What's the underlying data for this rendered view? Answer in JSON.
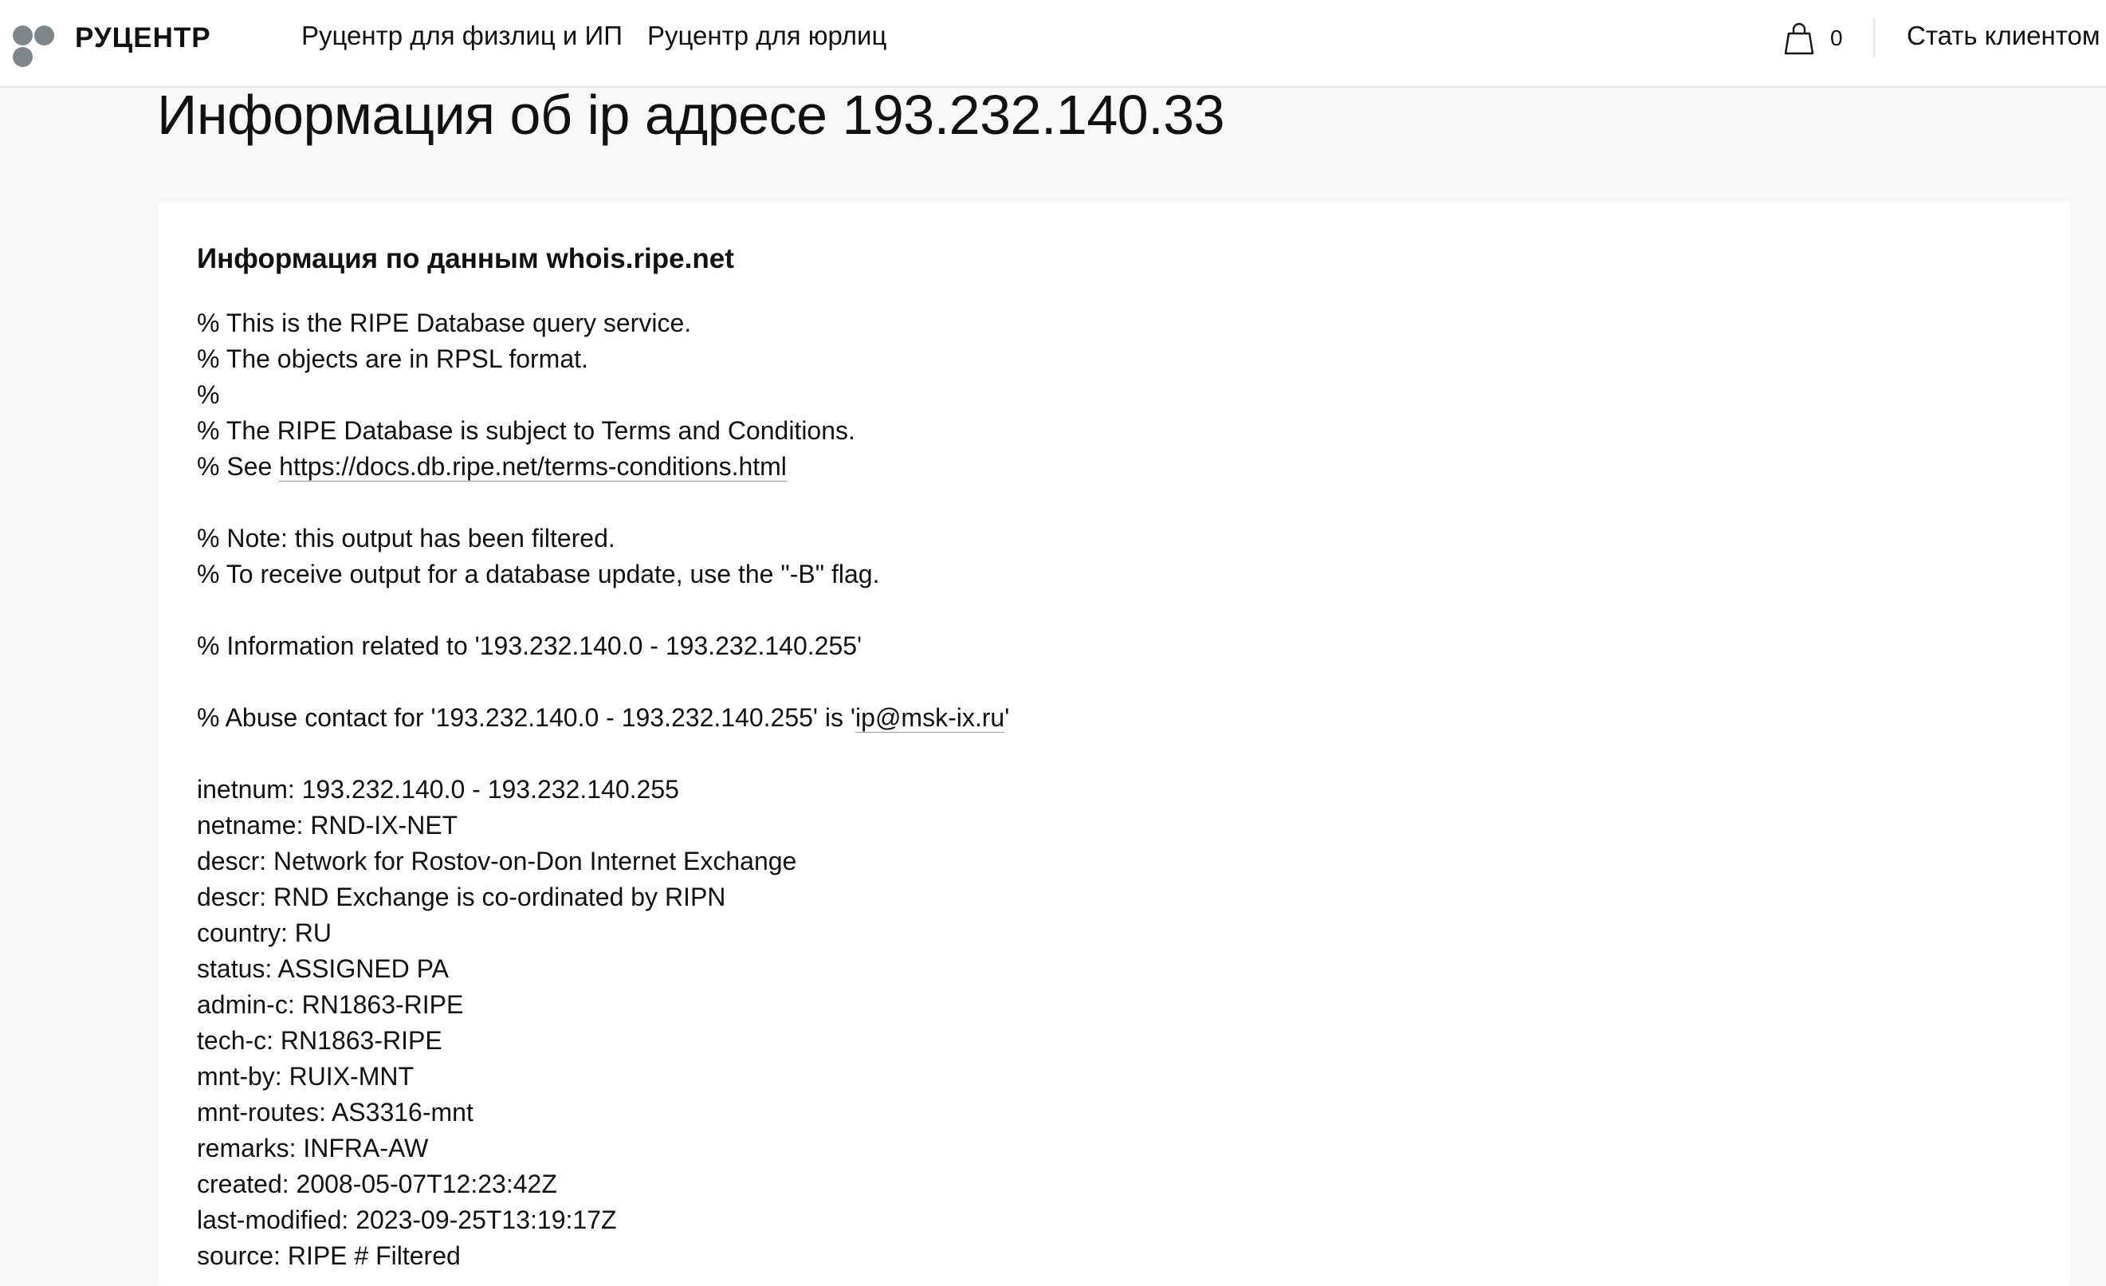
{
  "header": {
    "logo_text": "РУЦЕНТР",
    "nav": [
      "Руцентр для физлиц и ИП",
      "Руцентр для юрлиц"
    ],
    "cart_count": "0",
    "cta_label": "Стать клиентом",
    "icons": [
      "logo-dots-icon",
      "shopping-bag-icon"
    ]
  },
  "page": {
    "title": "Информация об ip адресе 193.232.140.33"
  },
  "whois": {
    "heading": "Информация по данным whois.ripe.net",
    "line_01": "% This is the RIPE Database query service.",
    "line_02": "% The objects are in RPSL format.",
    "line_03": "%",
    "line_04": "% The RIPE Database is subject to Terms and Conditions.",
    "line_05_prefix": "% See ",
    "line_05_link": "https://docs.db.ripe.net/terms-conditions.html",
    "line_07": "% Note: this output has been filtered.",
    "line_08": "% To receive output for a database update, use the \"-B\" flag.",
    "line_10": "% Information related to '193.232.140.0 - 193.232.140.255'",
    "line_12_prefix": "% Abuse contact for '193.232.140.0 - 193.232.140.255' is '",
    "line_12_link": "ip@msk-ix.ru",
    "line_12_suffix": "'",
    "records": [
      "inetnum: 193.232.140.0 - 193.232.140.255",
      "netname: RND-IX-NET",
      "descr: Network for Rostov-on-Don Internet Exchange",
      "descr: RND Exchange is co-ordinated by RIPN",
      "country: RU",
      "status: ASSIGNED PA",
      "admin-c: RN1863-RIPE",
      "tech-c: RN1863-RIPE",
      "mnt-by: RUIX-MNT",
      "mnt-routes: AS3316-mnt",
      "remarks: INFRA-AW",
      "created: 2008-05-07T12:23:42Z",
      "last-modified: 2023-09-25T13:19:17Z",
      "source: RIPE # Filtered"
    ]
  }
}
